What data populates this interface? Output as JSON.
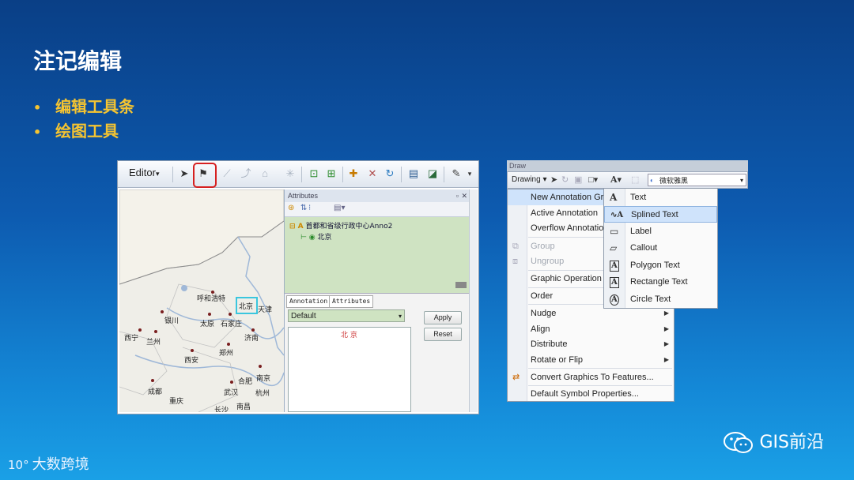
{
  "slide": {
    "title": "注记编辑",
    "bullets": [
      "编辑工具条",
      "绘图工具"
    ],
    "brand": "GIS前沿",
    "watermark": "大数跨境",
    "watermark_mark": "10°"
  },
  "editor": {
    "toolbar_label": "Editor",
    "toolbar_arrow": "▾",
    "attributes_title": "Attributes",
    "tree": {
      "layer": "首都和省级行政中心Anno2",
      "feature": "北京"
    },
    "tabs": [
      "Annotation",
      "Attributes"
    ],
    "symbol_select": "Default",
    "annotation_text": "北 京",
    "apply_label": "Apply",
    "reset_label": "Reset",
    "map_cities": [
      "呼和浩特",
      "北京",
      "天津",
      "银川",
      "太原",
      "石家庄",
      "西宁",
      "兰州",
      "济南",
      "郑州",
      "西安",
      "合肥",
      "南京",
      "成都",
      "武汉",
      "杭州",
      "重庆",
      "长沙",
      "南昌"
    ]
  },
  "draw": {
    "title": "Draw",
    "drawing_label": "Drawing",
    "font_name": "微软雅黑",
    "menu_items": [
      {
        "label": "New Annotation Gr",
        "dim": false,
        "sub": true,
        "hl": true
      },
      {
        "label": "Active Annotation",
        "dim": false,
        "sub": false,
        "hl": false
      },
      {
        "label": "Overflow Annotatio",
        "dim": false,
        "sub": false,
        "hl": false
      },
      {
        "label": "Group",
        "dim": true,
        "sub": false,
        "hl": false
      },
      {
        "label": "Ungroup",
        "dim": true,
        "sub": false,
        "hl": false
      },
      {
        "label": "Graphic Operation",
        "dim": false,
        "sub": false,
        "hl": false
      },
      {
        "label": "Order",
        "dim": false,
        "sub": false,
        "hl": false
      },
      {
        "label": "Nudge",
        "dim": false,
        "sub": true,
        "hl": false
      },
      {
        "label": "Align",
        "dim": false,
        "sub": true,
        "hl": false
      },
      {
        "label": "Distribute",
        "dim": false,
        "sub": true,
        "hl": false
      },
      {
        "label": "Rotate or Flip",
        "dim": false,
        "sub": true,
        "hl": false
      },
      {
        "label": "Convert Graphics To Features...",
        "dim": false,
        "sub": false,
        "hl": false
      },
      {
        "label": "Default Symbol Properties...",
        "dim": false,
        "sub": false,
        "hl": false
      }
    ],
    "submenu_items": [
      {
        "label": "Text",
        "icon": "A",
        "hl": false
      },
      {
        "label": "Splined Text",
        "icon": "ↄA",
        "hl": true
      },
      {
        "label": "Label",
        "icon": "▭",
        "hl": false
      },
      {
        "label": "Callout",
        "icon": "▱",
        "hl": false
      },
      {
        "label": "Polygon Text",
        "icon": "A",
        "hl": false
      },
      {
        "label": "Rectangle Text",
        "icon": "A",
        "hl": false
      },
      {
        "label": "Circle Text",
        "icon": "A",
        "hl": false
      }
    ]
  },
  "colors": {
    "title": "#ffffff",
    "bullet": "#f5c431",
    "highlight_box": "#d62020",
    "menu_highlight": "#cfe3fb"
  }
}
